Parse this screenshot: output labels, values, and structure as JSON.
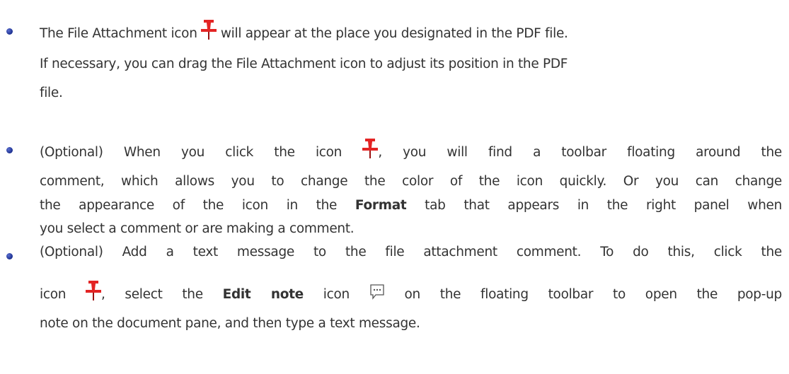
{
  "bullets": [
    {
      "line1_before": "The File Attachment icon",
      "line1_icon": "pushpin-icon",
      "line1_after": "will appear at the place you designated in the PDF file.",
      "line2": "If necessary, you can drag the File Attachment icon to adjust its position in the PDF",
      "line3": "file."
    },
    {
      "line1_before": "(Optional) When you click the icon",
      "line1_icon": "pushpin-icon",
      "line1_after": ", you will find a toolbar floating around the",
      "line2": "comment, which allows you to change the color of the icon quickly. Or you can change",
      "line3_before": "the appearance of the icon in the",
      "line3_bold": "Format",
      "line3_after": "tab that appears in the right panel when",
      "line4": "you select a comment or are making a comment."
    },
    {
      "line1": "(Optional) Add a text message to the file attachment comment. To do this, click the",
      "line2_before": "icon",
      "line2_icon": "pushpin-icon",
      "line2_mid1": ", select the",
      "line2_bold": "Edit note",
      "line2_mid2": "icon",
      "line2_icon2": "comment-bubble-icon",
      "line2_after": "on the floating toolbar to open the pop-up",
      "line3": "note on the document pane, and then type a text message."
    }
  ],
  "colors": {
    "text": "#333333",
    "pin_red": "#e32424",
    "pin_dark": "#9a1010",
    "bullet": "#1b2f8f",
    "bubble_stroke": "#555555"
  }
}
